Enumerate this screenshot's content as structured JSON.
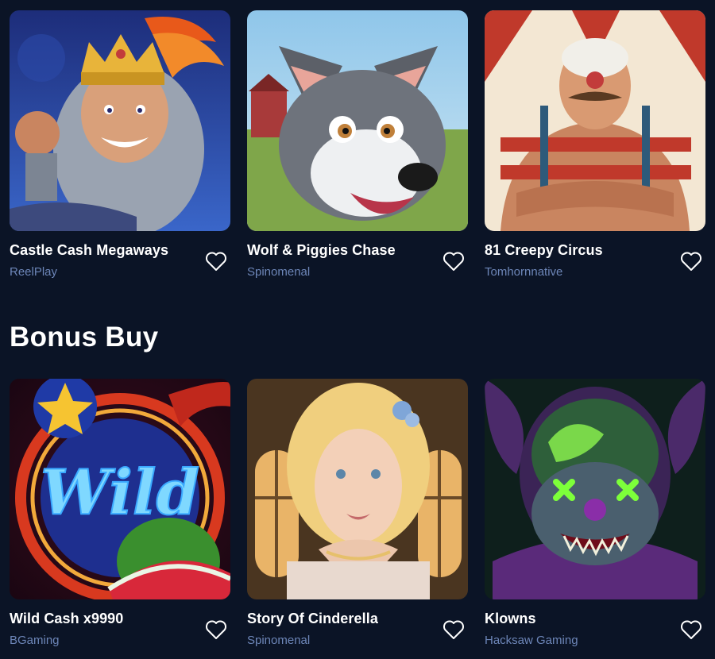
{
  "section": {
    "title": "Bonus Buy"
  },
  "top_games": [
    {
      "title": "Castle Cash Megaways",
      "provider": "ReelPlay",
      "art": "knight-king"
    },
    {
      "title": "Wolf & Piggies Chase",
      "provider": "Spinomenal",
      "art": "cartoon-wolf"
    },
    {
      "title": "81 Creepy Circus",
      "provider": "Tomhornnative",
      "art": "circus-strongman-clown"
    }
  ],
  "bonus_buy_games": [
    {
      "title": "Wild Cash x9990",
      "provider": "BGaming",
      "art": "wild-neon-fruit"
    },
    {
      "title": "Story Of Cinderella",
      "provider": "Spinomenal",
      "art": "cinderella-portrait"
    },
    {
      "title": "Klowns",
      "provider": "Hacksaw Gaming",
      "art": "green-neon-clown"
    }
  ],
  "icons": {
    "favorite": "heart-outline-icon"
  },
  "colors": {
    "background": "#0b1426",
    "title": "#ffffff",
    "provider": "#6d86b8"
  }
}
